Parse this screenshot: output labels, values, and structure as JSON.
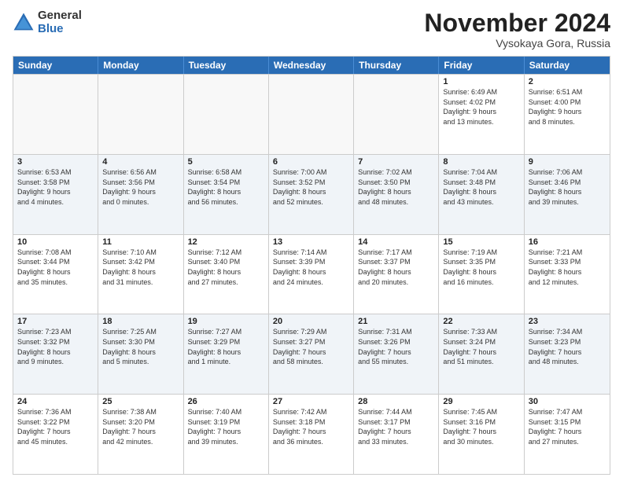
{
  "logo": {
    "general": "General",
    "blue": "Blue"
  },
  "title": "November 2024",
  "location": "Vysokaya Gora, Russia",
  "headers": [
    "Sunday",
    "Monday",
    "Tuesday",
    "Wednesday",
    "Thursday",
    "Friday",
    "Saturday"
  ],
  "rows": [
    [
      {
        "day": "",
        "text": "",
        "empty": true
      },
      {
        "day": "",
        "text": "",
        "empty": true
      },
      {
        "day": "",
        "text": "",
        "empty": true
      },
      {
        "day": "",
        "text": "",
        "empty": true
      },
      {
        "day": "",
        "text": "",
        "empty": true
      },
      {
        "day": "1",
        "text": "Sunrise: 6:49 AM\nSunset: 4:02 PM\nDaylight: 9 hours\nand 13 minutes."
      },
      {
        "day": "2",
        "text": "Sunrise: 6:51 AM\nSunset: 4:00 PM\nDaylight: 9 hours\nand 8 minutes."
      }
    ],
    [
      {
        "day": "3",
        "text": "Sunrise: 6:53 AM\nSunset: 3:58 PM\nDaylight: 9 hours\nand 4 minutes."
      },
      {
        "day": "4",
        "text": "Sunrise: 6:56 AM\nSunset: 3:56 PM\nDaylight: 9 hours\nand 0 minutes."
      },
      {
        "day": "5",
        "text": "Sunrise: 6:58 AM\nSunset: 3:54 PM\nDaylight: 8 hours\nand 56 minutes."
      },
      {
        "day": "6",
        "text": "Sunrise: 7:00 AM\nSunset: 3:52 PM\nDaylight: 8 hours\nand 52 minutes."
      },
      {
        "day": "7",
        "text": "Sunrise: 7:02 AM\nSunset: 3:50 PM\nDaylight: 8 hours\nand 48 minutes."
      },
      {
        "day": "8",
        "text": "Sunrise: 7:04 AM\nSunset: 3:48 PM\nDaylight: 8 hours\nand 43 minutes."
      },
      {
        "day": "9",
        "text": "Sunrise: 7:06 AM\nSunset: 3:46 PM\nDaylight: 8 hours\nand 39 minutes."
      }
    ],
    [
      {
        "day": "10",
        "text": "Sunrise: 7:08 AM\nSunset: 3:44 PM\nDaylight: 8 hours\nand 35 minutes."
      },
      {
        "day": "11",
        "text": "Sunrise: 7:10 AM\nSunset: 3:42 PM\nDaylight: 8 hours\nand 31 minutes."
      },
      {
        "day": "12",
        "text": "Sunrise: 7:12 AM\nSunset: 3:40 PM\nDaylight: 8 hours\nand 27 minutes."
      },
      {
        "day": "13",
        "text": "Sunrise: 7:14 AM\nSunset: 3:39 PM\nDaylight: 8 hours\nand 24 minutes."
      },
      {
        "day": "14",
        "text": "Sunrise: 7:17 AM\nSunset: 3:37 PM\nDaylight: 8 hours\nand 20 minutes."
      },
      {
        "day": "15",
        "text": "Sunrise: 7:19 AM\nSunset: 3:35 PM\nDaylight: 8 hours\nand 16 minutes."
      },
      {
        "day": "16",
        "text": "Sunrise: 7:21 AM\nSunset: 3:33 PM\nDaylight: 8 hours\nand 12 minutes."
      }
    ],
    [
      {
        "day": "17",
        "text": "Sunrise: 7:23 AM\nSunset: 3:32 PM\nDaylight: 8 hours\nand 9 minutes."
      },
      {
        "day": "18",
        "text": "Sunrise: 7:25 AM\nSunset: 3:30 PM\nDaylight: 8 hours\nand 5 minutes."
      },
      {
        "day": "19",
        "text": "Sunrise: 7:27 AM\nSunset: 3:29 PM\nDaylight: 8 hours\nand 1 minute."
      },
      {
        "day": "20",
        "text": "Sunrise: 7:29 AM\nSunset: 3:27 PM\nDaylight: 7 hours\nand 58 minutes."
      },
      {
        "day": "21",
        "text": "Sunrise: 7:31 AM\nSunset: 3:26 PM\nDaylight: 7 hours\nand 55 minutes."
      },
      {
        "day": "22",
        "text": "Sunrise: 7:33 AM\nSunset: 3:24 PM\nDaylight: 7 hours\nand 51 minutes."
      },
      {
        "day": "23",
        "text": "Sunrise: 7:34 AM\nSunset: 3:23 PM\nDaylight: 7 hours\nand 48 minutes."
      }
    ],
    [
      {
        "day": "24",
        "text": "Sunrise: 7:36 AM\nSunset: 3:22 PM\nDaylight: 7 hours\nand 45 minutes."
      },
      {
        "day": "25",
        "text": "Sunrise: 7:38 AM\nSunset: 3:20 PM\nDaylight: 7 hours\nand 42 minutes."
      },
      {
        "day": "26",
        "text": "Sunrise: 7:40 AM\nSunset: 3:19 PM\nDaylight: 7 hours\nand 39 minutes."
      },
      {
        "day": "27",
        "text": "Sunrise: 7:42 AM\nSunset: 3:18 PM\nDaylight: 7 hours\nand 36 minutes."
      },
      {
        "day": "28",
        "text": "Sunrise: 7:44 AM\nSunset: 3:17 PM\nDaylight: 7 hours\nand 33 minutes."
      },
      {
        "day": "29",
        "text": "Sunrise: 7:45 AM\nSunset: 3:16 PM\nDaylight: 7 hours\nand 30 minutes."
      },
      {
        "day": "30",
        "text": "Sunrise: 7:47 AM\nSunset: 3:15 PM\nDaylight: 7 hours\nand 27 minutes."
      }
    ]
  ]
}
